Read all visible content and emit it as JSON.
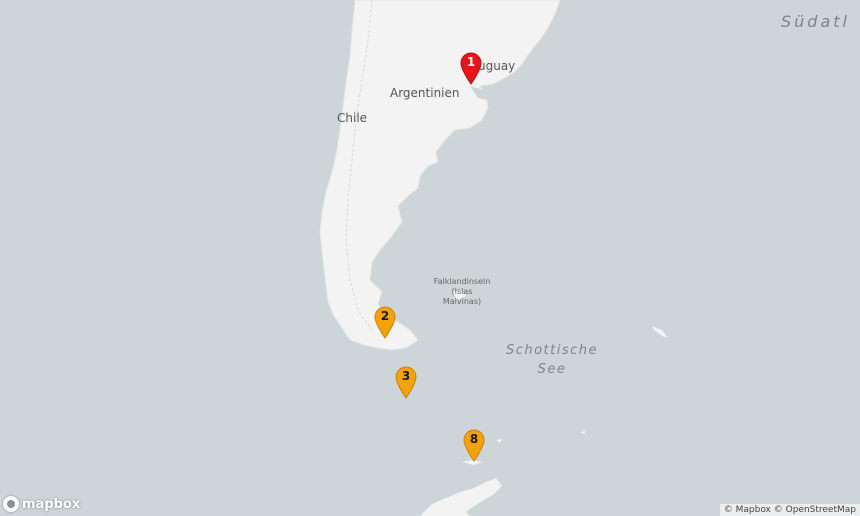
{
  "map": {
    "labels": {
      "argentina": "Argentinien",
      "chile": "Chile",
      "uruguay": "uguay",
      "falklands_line1": "Falklandinseln",
      "falklands_line2": "(Islas",
      "falklands_line3": "Malvinas)",
      "scotia_line1": "Schottische",
      "scotia_line2": "See",
      "ocean": "Südatl"
    },
    "markers": [
      {
        "label": "1",
        "color": "#e8131b"
      },
      {
        "label": "2",
        "color": "#f5a20a"
      },
      {
        "label": "3",
        "color": "#f5a20a"
      },
      {
        "label": "8",
        "color": "#f5a20a"
      }
    ],
    "colors": {
      "water": "#cdd5d8",
      "land": "#f3f3f3"
    }
  },
  "branding": {
    "logo_text": "mapbox",
    "logo_icon": "mapbox-logo-icon"
  },
  "attribution": {
    "mapbox": "© Mapbox",
    "osm": "© OpenStreetMap"
  }
}
